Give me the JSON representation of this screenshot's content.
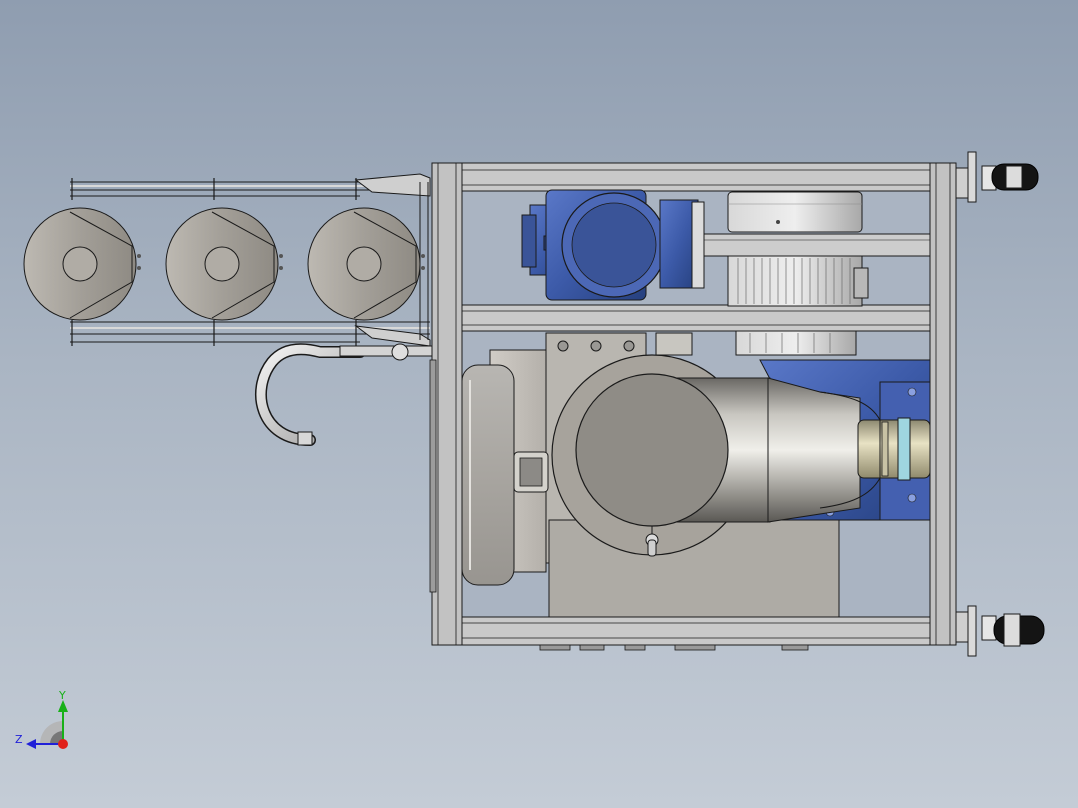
{
  "triad": {
    "y_label": "Y",
    "z_label": "Z",
    "x_color": "#e0201a",
    "y_color": "#18b018",
    "z_color": "#2020d8"
  },
  "colors": {
    "background_top": "#8f9db0",
    "background_bottom": "#c4ccd6",
    "frame_steel": "#c8c8c8",
    "motor_blue": "#3c5aa8",
    "drum_gray": "#a7a39c",
    "shaft_cream": "#d8d2b0",
    "edge_line": "#1a1a1a"
  }
}
